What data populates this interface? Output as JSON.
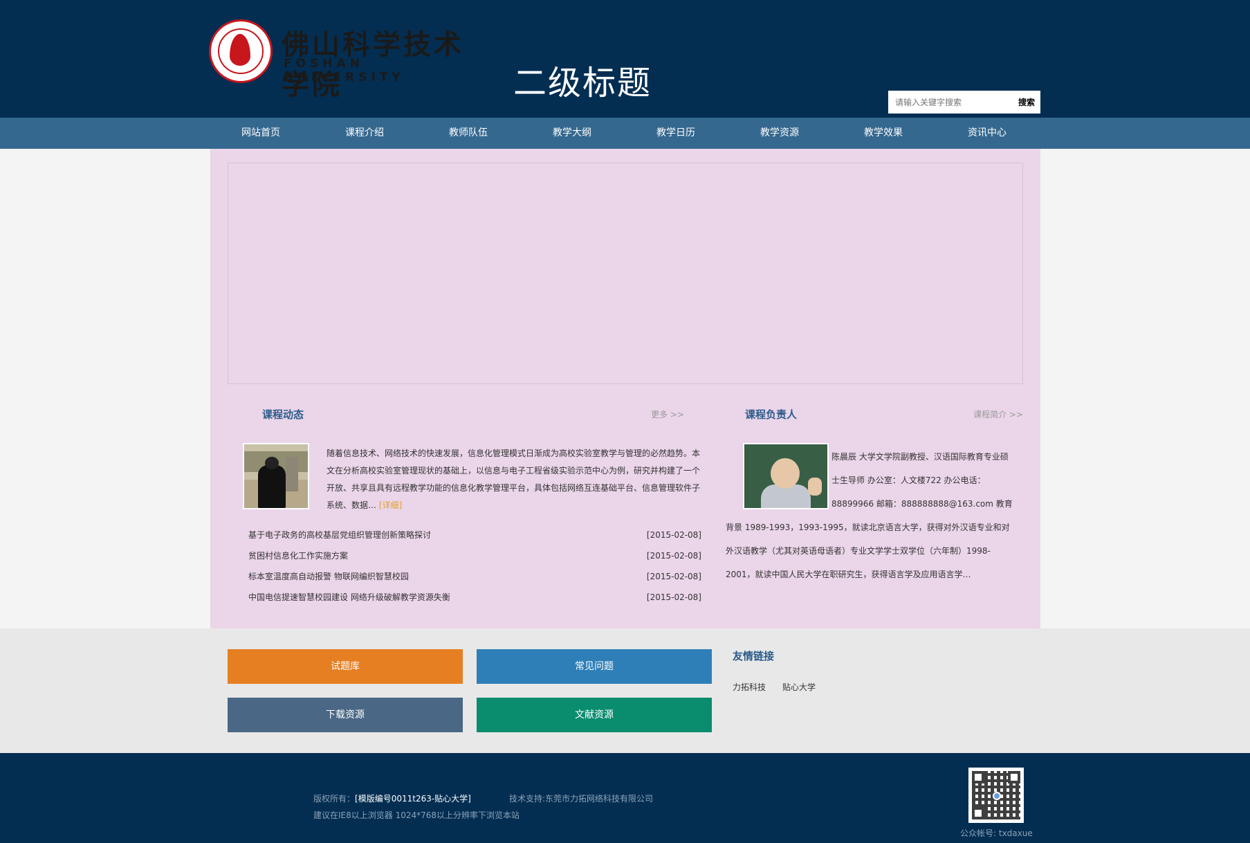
{
  "header": {
    "logo_cn": "佛山科学技术学院",
    "logo_en": "FOSHAN UNIVERSITY",
    "site_title": "二级标题",
    "search_placeholder": "请输入关键字搜索",
    "search_button": "搜索"
  },
  "nav": [
    "网站首页",
    "课程介绍",
    "教师队伍",
    "教学大纲",
    "教学日历",
    "教学资源",
    "教学效果",
    "资讯中心"
  ],
  "news_section": {
    "title": "课程动态",
    "more": "更多 >>",
    "intro": "随着信息技术、网络技术的快速发展，信息化管理模式日渐成为高校实验室教学与管理的必然趋势。本文在分析高校实验室管理现状的基础上，以信息与电子工程省级实验示范中心为例，研究并构建了一个开放、共享且具有远程教学功能的信息化教学管理平台，具体包括网络互连基础平台、信息管理软件子系统、数据…",
    "detail_link": "[详细]",
    "items": [
      {
        "title": "基于电子政务的高校基层党组织管理创新策略探讨",
        "date": "[2015-02-08]"
      },
      {
        "title": "贫困村信息化工作实施方案",
        "date": "[2015-02-08]"
      },
      {
        "title": "标本室温度高自动报警 物联网编织智慧校园",
        "date": "[2015-02-08]"
      },
      {
        "title": "中国电信提速智慧校园建设 网络升级破解教学资源失衡",
        "date": "[2015-02-08]"
      }
    ]
  },
  "leader_section": {
    "title": "课程负责人",
    "more": "课程简介 >>",
    "bio": "陈晨辰 大学文学院副教授、汉语国际教育专业硕士生导师 办公室：人文楼722 办公电话：88899966 邮箱：888888888@163.com 教育背景 1989-1993，1993-1995，就读北京语言大学，获得对外汉语专业和对外汉语教学（尤其对英语母语者）专业文学学士双学位（六年制）1998-2001，就读中国人民大学在职研究生，获得语言学及应用语言学…"
  },
  "tiles": [
    {
      "label": "试题库",
      "color": "#e67e22"
    },
    {
      "label": "常见问题",
      "color": "#2e7fb8"
    },
    {
      "label": "下载资源",
      "color": "#4a6785"
    },
    {
      "label": "文献资源",
      "color": "#0a8c6e"
    }
  ],
  "friends": {
    "title": "友情链接",
    "links": [
      "力拓科技",
      "贴心大学"
    ]
  },
  "footer": {
    "copyright_label": "版权所有：",
    "copyright_value": "[模版编号0011t263-贴心大学]",
    "support": "技术支持:东莞市力拓网络科技有限公司",
    "browser_note": "建议在IE8以上浏览器 1024*768以上分辨率下浏览本站",
    "wechat": "公众帐号: txdaxue"
  }
}
